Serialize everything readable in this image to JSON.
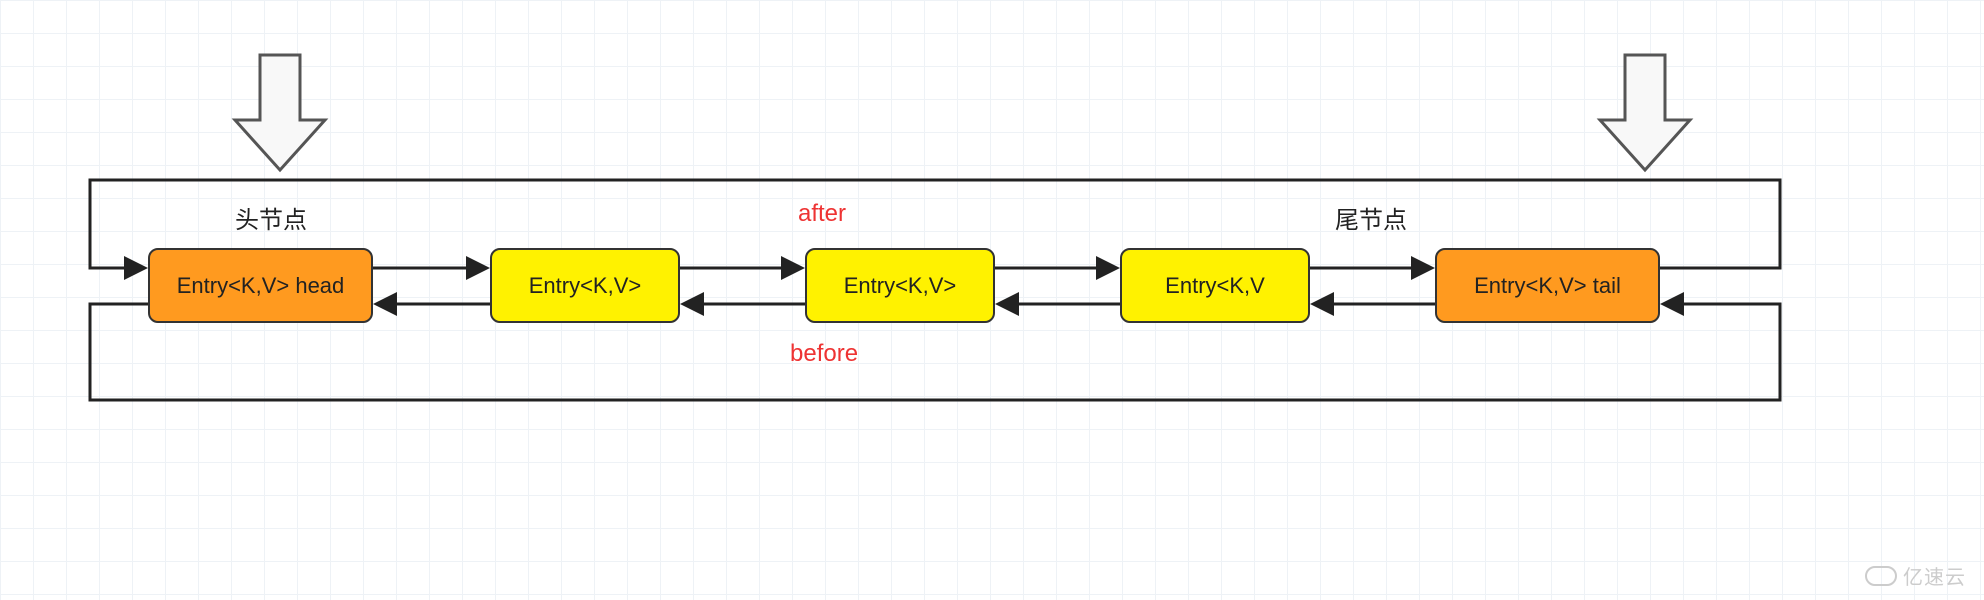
{
  "diagram": {
    "head_label": "头节点",
    "tail_label": "尾节点",
    "after_label": "after",
    "before_label": "before",
    "nodes": [
      {
        "id": "head",
        "text": "Entry<K,V> head",
        "color": "orange"
      },
      {
        "id": "n2",
        "text": "Entry<K,V>",
        "color": "yellow"
      },
      {
        "id": "n3",
        "text": "Entry<K,V>",
        "color": "yellow"
      },
      {
        "id": "n4",
        "text": "Entry<K,V",
        "color": "yellow"
      },
      {
        "id": "tail",
        "text": "Entry<K,V> tail",
        "color": "orange"
      }
    ],
    "pointers": {
      "forward": "after",
      "backward": "before",
      "wrap": true
    }
  },
  "watermark": "亿速云"
}
